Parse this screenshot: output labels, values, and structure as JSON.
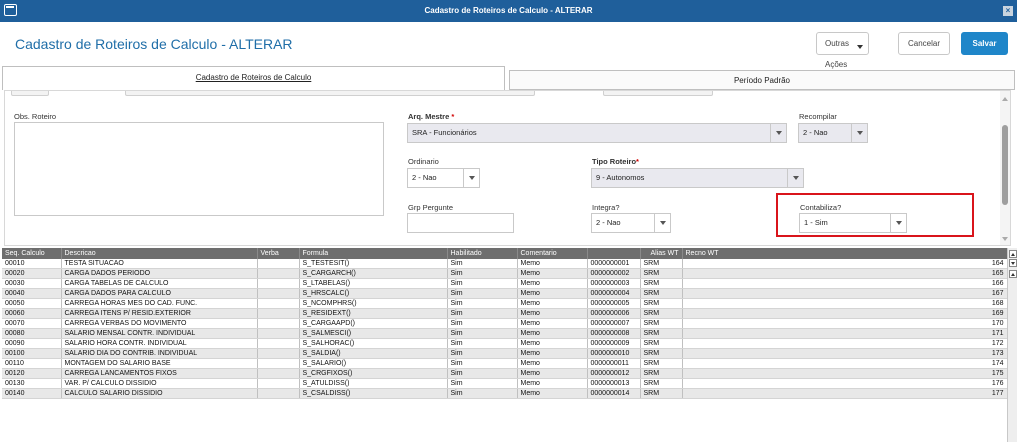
{
  "window": {
    "title": "Cadastro de Roteiros de Calculo - ALTERAR",
    "close_label": "×"
  },
  "header": {
    "title": "Cadastro de Roteiros de Calculo - ALTERAR",
    "buttons": {
      "outras": "Outras Ações",
      "cancelar": "Cancelar",
      "salvar": "Salvar"
    }
  },
  "tabs": [
    {
      "label": "Cadastro de Roteiros de Calculo",
      "active": true
    },
    {
      "label": "Período Padrão",
      "active": false
    }
  ],
  "form": {
    "obs_roteiro": {
      "label": "Obs. Roteiro",
      "value": ""
    },
    "arq_mestre": {
      "label": "Arq. Mestre",
      "required_mark": "*",
      "value": "SRA - Funcionários"
    },
    "recompilar": {
      "label": "Recompilar",
      "value": "2 - Nao"
    },
    "ordinario": {
      "label": "Ordinario",
      "value": "2 - Nao"
    },
    "tipo_roteiro": {
      "label": "Tipo Roteiro",
      "required_mark": "*",
      "value": "9 - Autonomos"
    },
    "grp_pergunte": {
      "label": "Grp Pergunte",
      "value": ""
    },
    "integra": {
      "label": "Integra?",
      "value": "2 - Nao"
    },
    "contabiliza": {
      "label": "Contabiliza?",
      "value": "1 - Sim"
    }
  },
  "grid": {
    "columns": [
      "Seq. Calculo",
      "Descricao",
      "Verba",
      "Formula",
      "Habilitado",
      "Comentario",
      "",
      "Alias WT",
      "Recno WT"
    ],
    "rows": [
      [
        "00010",
        "TESTA SITUACAO",
        "",
        "S_TESTESIT()",
        "Sim",
        "Memo",
        "0000000001",
        "SRM",
        "164"
      ],
      [
        "00020",
        "CARGA DADOS PERIODO",
        "",
        "S_CARGARCH()",
        "Sim",
        "Memo",
        "0000000002",
        "SRM",
        "165"
      ],
      [
        "00030",
        "CARGA TABELAS DE CALCULO",
        "",
        "S_LTABELAS()",
        "Sim",
        "Memo",
        "0000000003",
        "SRM",
        "166"
      ],
      [
        "00040",
        "CARGA DADOS PARA CALCULO",
        "",
        "S_HRSCALC()",
        "Sim",
        "Memo",
        "0000000004",
        "SRM",
        "167"
      ],
      [
        "00050",
        "CARREGA HORAS MES DO CAD. FUNC.",
        "",
        "S_NCOMPHRS()",
        "Sim",
        "Memo",
        "0000000005",
        "SRM",
        "168"
      ],
      [
        "00060",
        "CARREGA ITENS P/ RESID.EXTERIOR",
        "",
        "S_RESIDEXT()",
        "Sim",
        "Memo",
        "0000000006",
        "SRM",
        "169"
      ],
      [
        "00070",
        "CARREGA VERBAS DO MOVIMENTO",
        "",
        "S_CARGAAPD()",
        "Sim",
        "Memo",
        "0000000007",
        "SRM",
        "170"
      ],
      [
        "00080",
        "SALARIO MENSAL CONTR. INDIVIDUAL",
        "",
        "S_SALMESCI()",
        "Sim",
        "Memo",
        "0000000008",
        "SRM",
        "171"
      ],
      [
        "00090",
        "SALARIO HORA CONTR. INDIVIDUAL",
        "",
        "S_SALHORAC()",
        "Sim",
        "Memo",
        "0000000009",
        "SRM",
        "172"
      ],
      [
        "00100",
        "SALARIO DIA DO CONTRIB. INDIVIDUAL",
        "",
        "S_SALDIA()",
        "Sim",
        "Memo",
        "0000000010",
        "SRM",
        "173"
      ],
      [
        "00110",
        "MONTAGEM DO SALARIO BASE",
        "",
        "S_SALARIO()",
        "Sim",
        "Memo",
        "0000000011",
        "SRM",
        "174"
      ],
      [
        "00120",
        "CARREGA LANCAMENTOS FIXOS",
        "",
        "S_CRGFIXOS()",
        "Sim",
        "Memo",
        "0000000012",
        "SRM",
        "175"
      ],
      [
        "00130",
        "VAR. P/ CALCULO DISSIDIO",
        "",
        "S_ATULDISS()",
        "Sim",
        "Memo",
        "0000000013",
        "SRM",
        "176"
      ],
      [
        "00140",
        "CALCULO SALARIO DISSIDIO",
        "",
        "S_CSALDISS()",
        "Sim",
        "Memo",
        "0000000014",
        "SRM",
        "177"
      ]
    ]
  }
}
